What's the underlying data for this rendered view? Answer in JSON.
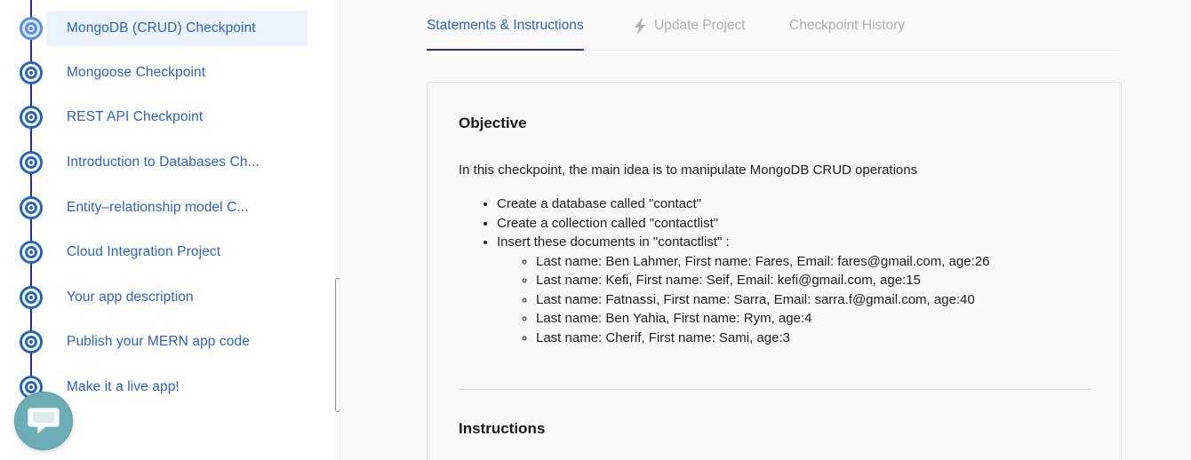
{
  "sidebar": {
    "items": [
      {
        "label": "MongoDB (CRUD) Checkpoint",
        "active": true
      },
      {
        "label": "Mongoose Checkpoint"
      },
      {
        "label": "REST API Checkpoint"
      },
      {
        "label": "Introduction to Databases Ch..."
      },
      {
        "label": "Entity–relationship model C..."
      },
      {
        "label": "Cloud Integration Project"
      },
      {
        "label": "Your app description"
      },
      {
        "label": "Publish your MERN app code"
      },
      {
        "label": "Make it a live app!"
      }
    ]
  },
  "tabs": [
    {
      "label": "Statements & Instructions",
      "active": true
    },
    {
      "label": "Update Project",
      "icon": "lightning-icon"
    },
    {
      "label": "Checkpoint History"
    }
  ],
  "content": {
    "objective_title": "Objective",
    "intro": "In this checkpoint, the main idea is to manipulate MongoDB CRUD operations",
    "bullets": [
      "Create a database called \"contact\"",
      "Create a collection called \"contactlist\"",
      "Insert these documents  in \"contactlist\" :"
    ],
    "documents": [
      "Last name: Ben Lahmer, First name: Fares, Email: fares@gmail.com, age:26",
      "Last name: Kefi, First name: Seif, Email: kefi@gmail.com, age:15",
      "Last name: Fatnassi, First name: Sarra, Email: sarra.f@gmail.com, age:40",
      "Last name: Ben Yahia, First name: Rym, age:4",
      "Last name: Cherif, First name: Sami, age:3"
    ],
    "instructions_title": "Instructions"
  },
  "colors": {
    "accent": "#2d61c8",
    "timeline": "#2d2aa8",
    "chat_button": "#6cadb6"
  }
}
